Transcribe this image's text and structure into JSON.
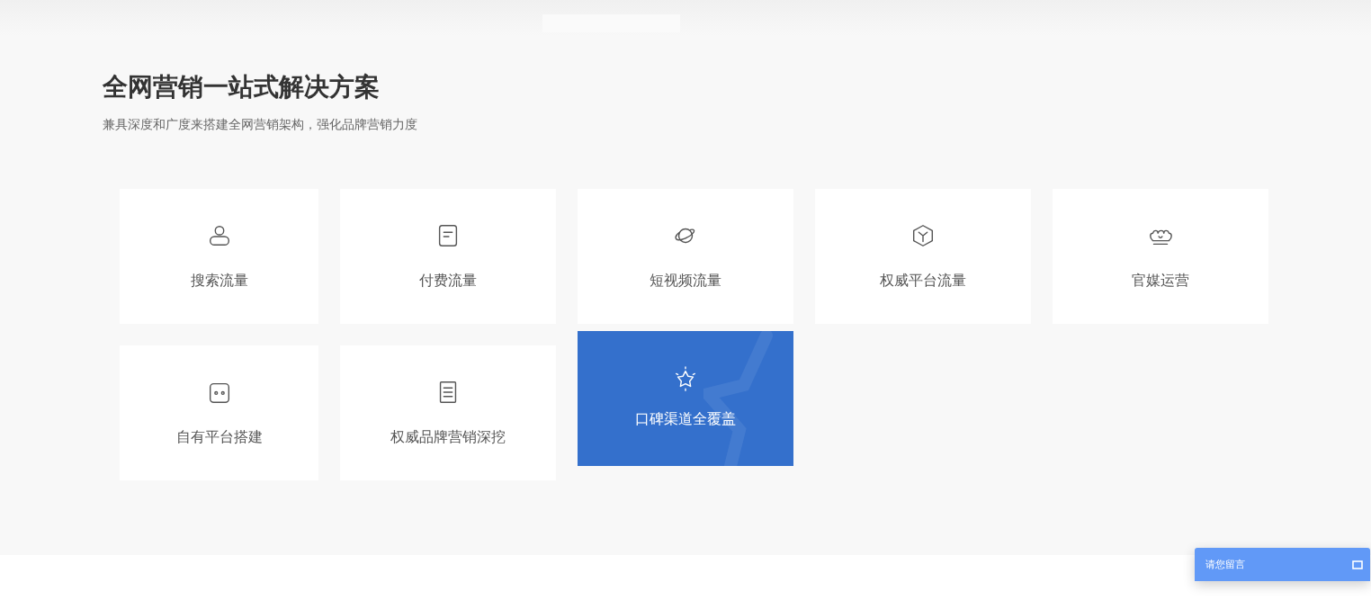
{
  "section": {
    "title": "全网营销一站式解决方案",
    "subtitle": "兼具深度和广度来搭建全网营销架构，强化品牌营销力度"
  },
  "cards": [
    {
      "label": "搜索流量",
      "selected": false
    },
    {
      "label": "付费流量",
      "selected": false
    },
    {
      "label": "短视频流量",
      "selected": false
    },
    {
      "label": "权威平台流量",
      "selected": false
    },
    {
      "label": "官媒运营",
      "selected": false
    },
    {
      "label": "自有平台搭建",
      "selected": false
    },
    {
      "label": "权威品牌营销深挖",
      "selected": false
    },
    {
      "label": "口碑渠道全覆盖",
      "selected": true
    }
  ],
  "chat_widget": {
    "label": "请您留言"
  }
}
